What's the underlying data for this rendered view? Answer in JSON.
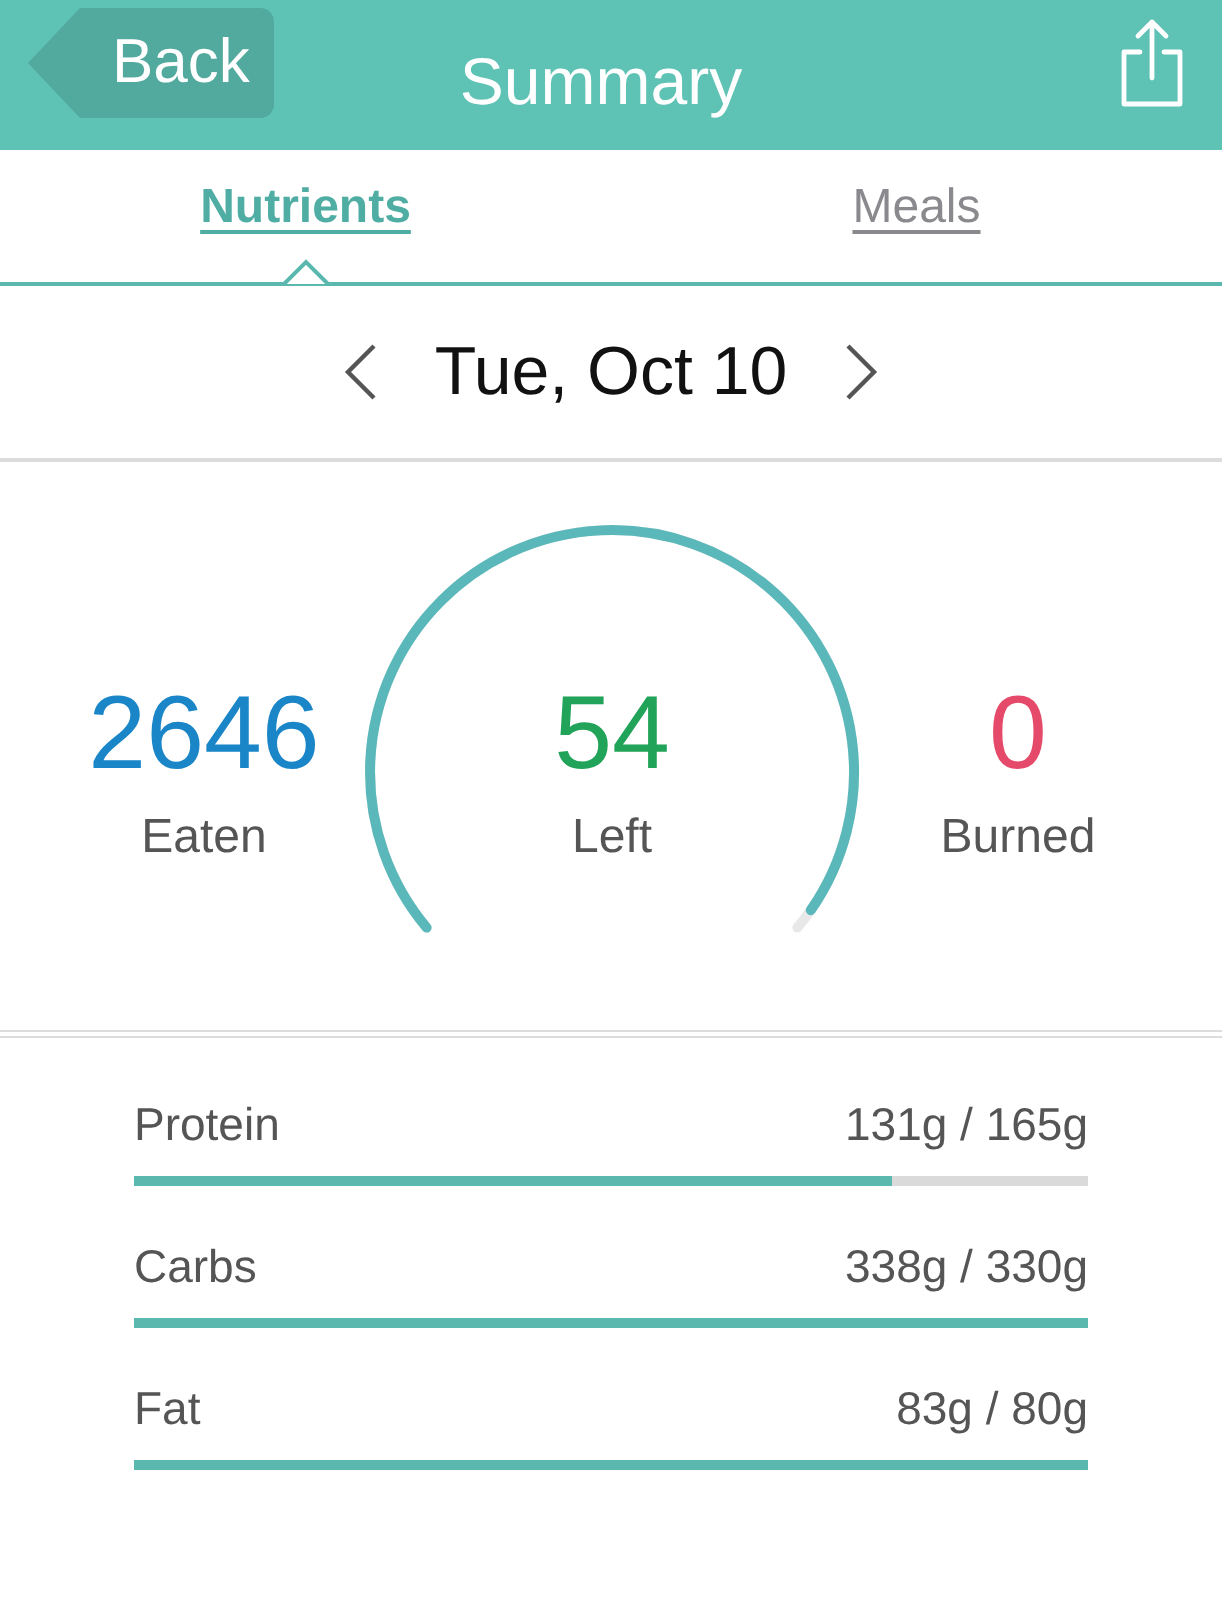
{
  "header": {
    "back": "Back",
    "title": "Summary"
  },
  "tabs": [
    {
      "label": "Nutrients",
      "selected": true
    },
    {
      "label": "Meals",
      "selected": false
    }
  ],
  "date": {
    "label": "Tue, Oct 10"
  },
  "calories": {
    "eaten": {
      "value": "2646",
      "label": "Eaten"
    },
    "left": {
      "value": "54",
      "label": "Left"
    },
    "burned": {
      "value": "0",
      "label": "Burned"
    }
  },
  "macros": [
    {
      "name": "Protein",
      "reading": "131g / 165g",
      "level": 0.794
    },
    {
      "name": "Carbs",
      "reading": "338g / 330g",
      "level": 1
    },
    {
      "name": "Fat",
      "reading": "83g / 80g",
      "level": 1
    }
  ]
}
